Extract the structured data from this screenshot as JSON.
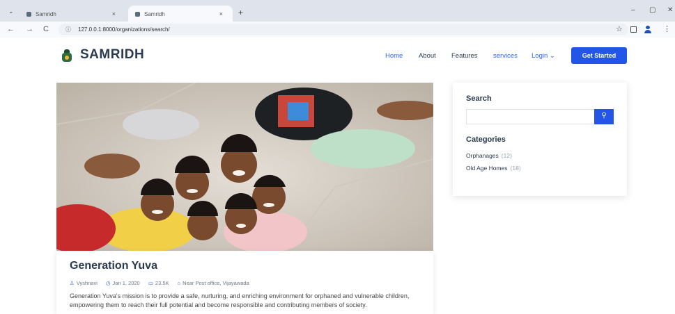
{
  "browser": {
    "tabs": [
      {
        "title": "Samridh",
        "close": "×"
      },
      {
        "title": "Samridh",
        "close": "×"
      }
    ],
    "tab_menu": "⌄",
    "new_tab": "+",
    "controls": {
      "minimize": "–",
      "maximize": "▢",
      "close": "✕"
    },
    "url": "127.0.0.1:8000/organizations/search/",
    "nav": {
      "back": "←",
      "forward": "→",
      "reload": "C",
      "info": "ⓘ",
      "star": "☆",
      "menu": "⋮"
    }
  },
  "header": {
    "brand": "SAMRIDH",
    "nav": [
      "Home",
      "About",
      "Features",
      "services",
      "Login ⌄"
    ],
    "cta": "Get Started"
  },
  "post": {
    "title": "Generation Yuva",
    "meta": {
      "author": "Vyshnavi",
      "date": "Jan 1, 2020",
      "count": "23.5K",
      "location": "Near Post office, Vijayawada"
    },
    "excerpt": "Generation Yuva's mission is to provide a safe, nurturing, and enriching environment for orphaned and vulnerable children, empowering them to reach their full potential and become responsible and contributing members of society."
  },
  "sidebar": {
    "search_title": "Search",
    "search_placeholder": "",
    "categories_title": "Categories",
    "categories": [
      {
        "name": "Orphanages",
        "count": "(12)"
      },
      {
        "name": "Old Age Homes",
        "count": "(18)"
      }
    ]
  },
  "colors": {
    "accent": "#2255e8",
    "brand_text": "#2b3b4f",
    "browser_chrome": "#dfe4ec"
  },
  "icons": {
    "author": "person-icon",
    "date": "clock-icon",
    "count": "comment-icon",
    "location": "home-icon",
    "search": "search-icon"
  }
}
